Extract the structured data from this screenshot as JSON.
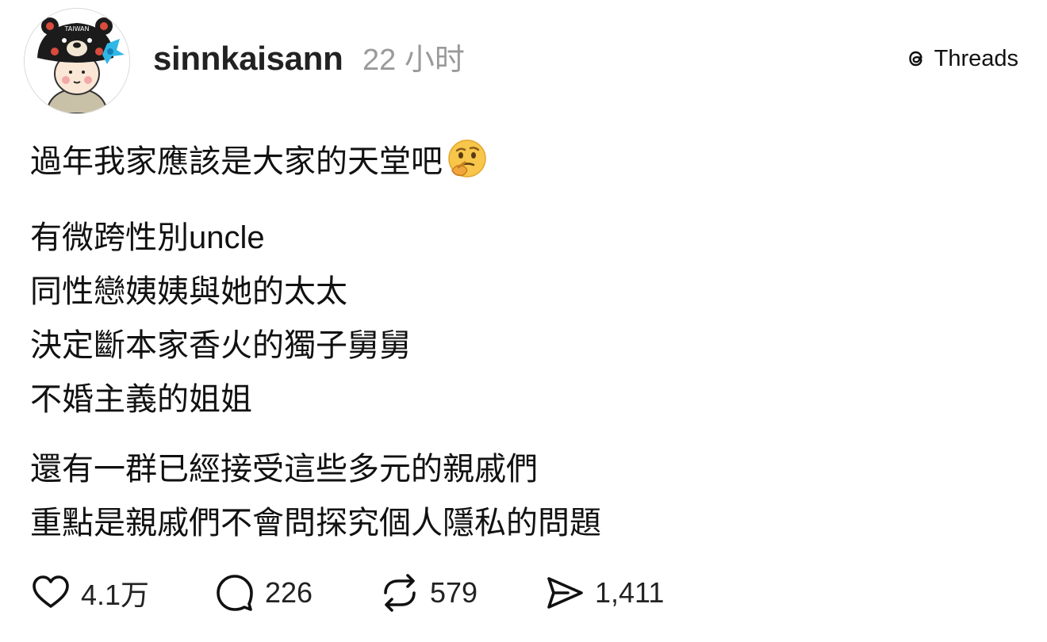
{
  "header": {
    "username": "sinnkaisann",
    "timestamp": "22 小时",
    "brand_label": "Threads",
    "avatar_cap_text": "TAIWAN"
  },
  "post": {
    "paragraphs": [
      [
        "過年我家應該是大家的天堂吧"
      ],
      [
        "有微跨性別uncle",
        "同性戀姨姨與她的太太",
        "決定斷本家香火的獨子舅舅",
        "不婚主義的姐姐"
      ],
      [
        "還有一群已經接受這些多元的親戚們",
        "重點是親戚們不會問探究個人隱私的問題"
      ]
    ],
    "emoji": "thinking-face"
  },
  "actions": {
    "likes": "4.1万",
    "comments": "226",
    "reposts": "579",
    "shares": "1,411"
  },
  "colors": {
    "username": "#222222",
    "timestamp": "#9a9a9a",
    "text": "#111111"
  }
}
